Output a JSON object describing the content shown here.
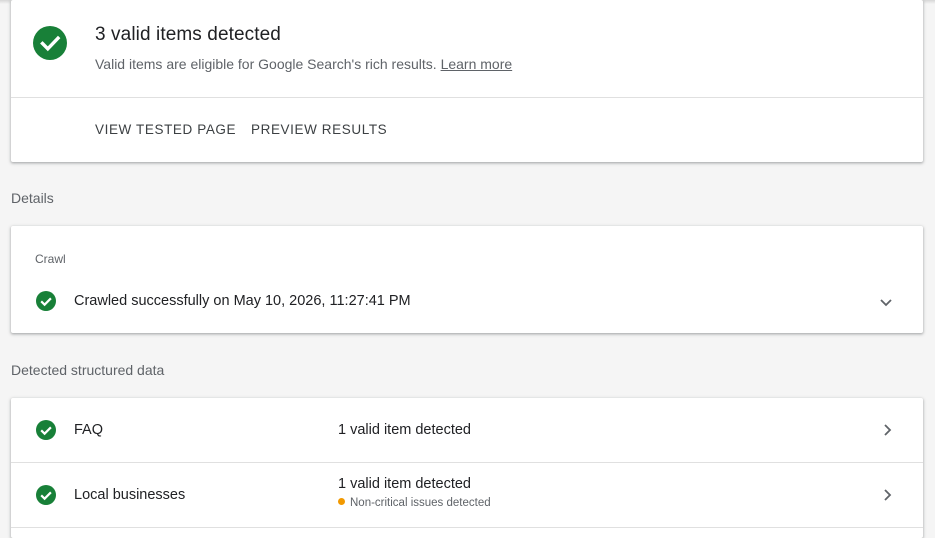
{
  "summary": {
    "title": "3 valid items detected",
    "subtitle": "Valid items are eligible for Google Search's rich results.",
    "learn_more": "Learn more",
    "actions": {
      "view_tested_page": "VIEW TESTED PAGE",
      "preview_results": "PREVIEW RESULTS"
    }
  },
  "details_label": "Details",
  "crawl": {
    "caption": "Crawl",
    "status": "Crawled successfully on May 10, 2026, 11:27:41 PM"
  },
  "structured_label": "Detected structured data",
  "structured_items": [
    {
      "name": "FAQ",
      "status": "1 valid item detected",
      "note": ""
    },
    {
      "name": "Local businesses",
      "status": "1 valid item detected",
      "note": "Non-critical issues detected"
    }
  ],
  "colors": {
    "valid_green": "#188038",
    "warning_orange": "#f29900",
    "background": "#f5f5f5"
  },
  "icons": {
    "valid": "check-circle-icon",
    "expand": "chevron-down-icon",
    "open": "chevron-right-icon",
    "warning": "warning-dot-icon"
  }
}
